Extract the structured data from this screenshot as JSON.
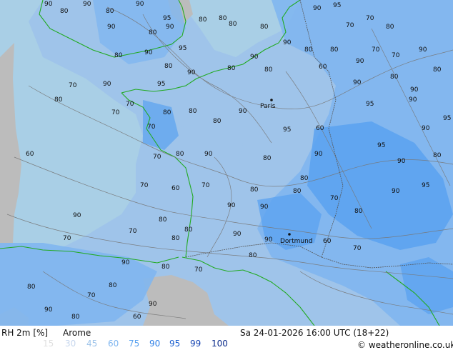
{
  "footer": {
    "variable": "RH 2m [%]",
    "model": "Arome",
    "datetime": "Sa 24-01-2026 16:00 UTC (18+22)",
    "copyright": "© weatheronline.co.uk"
  },
  "legend": {
    "values": [
      "15",
      "30",
      "45",
      "60",
      "75",
      "90",
      "95",
      "99",
      "100"
    ],
    "colors": [
      "#e0e0e0",
      "#c7d7ee",
      "#9fc4ea",
      "#7fb6f0",
      "#5aa2f0",
      "#2e7fe6",
      "#1a5fd0",
      "#0f3fb0",
      "#0a2a8a"
    ]
  },
  "map": {
    "cities": [
      "Paris",
      "Dortmund"
    ],
    "contour_labels": [
      {
        "t": "90"
      },
      {
        "t": "80"
      },
      {
        "t": "90"
      },
      {
        "t": "80"
      },
      {
        "t": "90"
      },
      {
        "t": "95"
      },
      {
        "t": "80"
      },
      {
        "t": "80"
      },
      {
        "t": "90"
      },
      {
        "t": "95"
      },
      {
        "t": "90"
      },
      {
        "t": "80"
      },
      {
        "t": "90"
      },
      {
        "t": "80"
      },
      {
        "t": "80"
      },
      {
        "t": "90"
      },
      {
        "t": "80"
      },
      {
        "t": "70"
      },
      {
        "t": "70"
      },
      {
        "t": "80"
      },
      {
        "t": "80"
      },
      {
        "t": "90"
      },
      {
        "t": "95"
      },
      {
        "t": "90"
      },
      {
        "t": "80"
      },
      {
        "t": "70"
      },
      {
        "t": "70"
      },
      {
        "t": "90"
      },
      {
        "t": "80"
      },
      {
        "t": "90"
      },
      {
        "t": "80"
      },
      {
        "t": "90"
      },
      {
        "t": "80"
      },
      {
        "t": "80"
      },
      {
        "t": "60"
      },
      {
        "t": "70"
      },
      {
        "t": "80"
      },
      {
        "t": "90"
      },
      {
        "t": "95"
      },
      {
        "t": "90"
      },
      {
        "t": "80"
      },
      {
        "t": "90"
      },
      {
        "t": "60"
      },
      {
        "t": "70"
      },
      {
        "t": "70"
      },
      {
        "t": "70"
      },
      {
        "t": "80"
      },
      {
        "t": "80"
      },
      {
        "t": "90"
      },
      {
        "t": "95"
      },
      {
        "t": "90"
      },
      {
        "t": "95"
      },
      {
        "t": "80"
      },
      {
        "t": "60"
      },
      {
        "t": "70"
      },
      {
        "t": "80"
      },
      {
        "t": "90"
      },
      {
        "t": "95"
      },
      {
        "t": "90"
      },
      {
        "t": "80"
      },
      {
        "t": "90"
      },
      {
        "t": "80"
      },
      {
        "t": "95"
      },
      {
        "t": "90"
      },
      {
        "t": "80"
      },
      {
        "t": "70"
      },
      {
        "t": "60"
      },
      {
        "t": "70"
      },
      {
        "t": "90"
      },
      {
        "t": "80"
      },
      {
        "t": "90"
      },
      {
        "t": "80"
      },
      {
        "t": "70"
      },
      {
        "t": "80"
      },
      {
        "t": "90"
      },
      {
        "t": "95"
      },
      {
        "t": "90"
      },
      {
        "t": "80"
      },
      {
        "t": "70"
      },
      {
        "t": "80"
      },
      {
        "t": "90"
      },
      {
        "t": "70"
      },
      {
        "t": "90"
      },
      {
        "t": "80"
      },
      {
        "t": "60"
      },
      {
        "t": "70"
      },
      {
        "t": "80"
      },
      {
        "t": "90"
      },
      {
        "t": "80"
      },
      {
        "t": "70"
      },
      {
        "t": "80"
      },
      {
        "t": "90"
      },
      {
        "t": "70"
      },
      {
        "t": "80"
      },
      {
        "t": "90"
      },
      {
        "t": "80"
      },
      {
        "t": "60"
      }
    ]
  }
}
